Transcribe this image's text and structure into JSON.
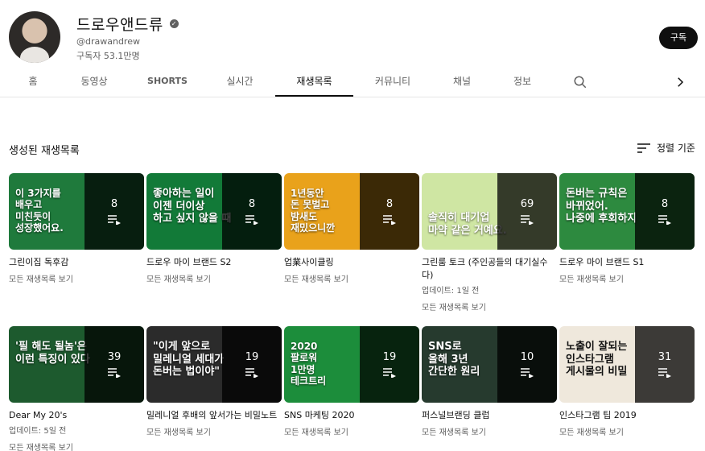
{
  "channel": {
    "name": "드로우앤드류",
    "handle": "@drawandrew",
    "subscribers": "구독자 53.1만명",
    "subscribe_label": "구독"
  },
  "tabs": [
    {
      "label": "홈"
    },
    {
      "label": "동영상"
    },
    {
      "label": "SHORTS"
    },
    {
      "label": "실시간"
    },
    {
      "label": "재생목록"
    },
    {
      "label": "커뮤니티"
    },
    {
      "label": "채널"
    },
    {
      "label": "정보"
    }
  ],
  "section": {
    "title": "생성된 재생목록",
    "sort_label": "정렬 기준"
  },
  "playlists": [
    {
      "title": "그린이집 독후감",
      "count": "8",
      "link": "모든 재생목록 보기",
      "bg": "#1f7a3c",
      "thumb_text": "이 3가지를\n배우고\n미친듯이\n성장했어요."
    },
    {
      "title": "드로우 마이 브랜드 S2",
      "count": "8",
      "link": "모든 재생목록 보기",
      "bg": "#127a38",
      "thumb_text": "좋아하는 일이\n이젠 더이상\n하고 싶지 않을 때"
    },
    {
      "title": "업業사이클링",
      "count": "8",
      "link": "모든 재생목록 보기",
      "bg": "#e9a21b",
      "thumb_text": "1년동안\n돈 못벌고\n밤새도\n재밌으니깐"
    },
    {
      "title": "그린룸 토크 (주인공들의 대기실수다)",
      "count": "69",
      "link": "모든 재생목록 보기",
      "updated": "업데이트: 1일 전",
      "bg": "#cfe6a3",
      "thumb_text": "솔직히 대기업\n마약 같은 거예요."
    },
    {
      "title": "드로우 마이 브랜드 S1",
      "count": "8",
      "link": "모든 재생목록 보기",
      "bg": "#2d8a3f",
      "thumb_text": "돈버는 규칙은\n바뀌었어.\n나중에 후회하지"
    },
    {
      "title": "Dear My 20's",
      "count": "39",
      "link": "모든 재생목록 보기",
      "updated": "업데이트: 5일 전",
      "bg": "#1d5a2e",
      "thumb_text": "'필 해도 될놈'은\n이런 특징이 있다"
    },
    {
      "title": "밀레니얼 후배의 앞서가는 비밀노트",
      "count": "19",
      "link": "모든 재생목록 보기",
      "bg": "#2b2b2b",
      "thumb_text": "\"이게 앞으로\n밀레니얼 세대가\n돈버는 법이야\""
    },
    {
      "title": "SNS 마케팅 2020",
      "count": "19",
      "link": "모든 재생목록 보기",
      "bg": "#1c8d3b",
      "thumb_text": "2020\n팔로워\n1만명\n테크트리"
    },
    {
      "title": "퍼스널브랜딩 클럽",
      "count": "10",
      "link": "모든 재생목록 보기",
      "bg": "#263a2e",
      "thumb_text": "SNS로\n올해 3년\n간단한 원리"
    },
    {
      "title": "인스타그램 팁 2019",
      "count": "31",
      "link": "모든 재생목록 보기",
      "bg": "#efe8dc",
      "thumb_text": "노출이 잘되는\n인스타그램\n게시물의 비밀"
    }
  ],
  "colors": {
    "accent": "#0f0f0f",
    "secondary_text": "#606060"
  },
  "icons": {
    "verified": "check-circle-icon",
    "search": "search-icon",
    "next": "chevron-right-icon",
    "sort": "sort-icon",
    "playlist": "playlist-icon"
  }
}
